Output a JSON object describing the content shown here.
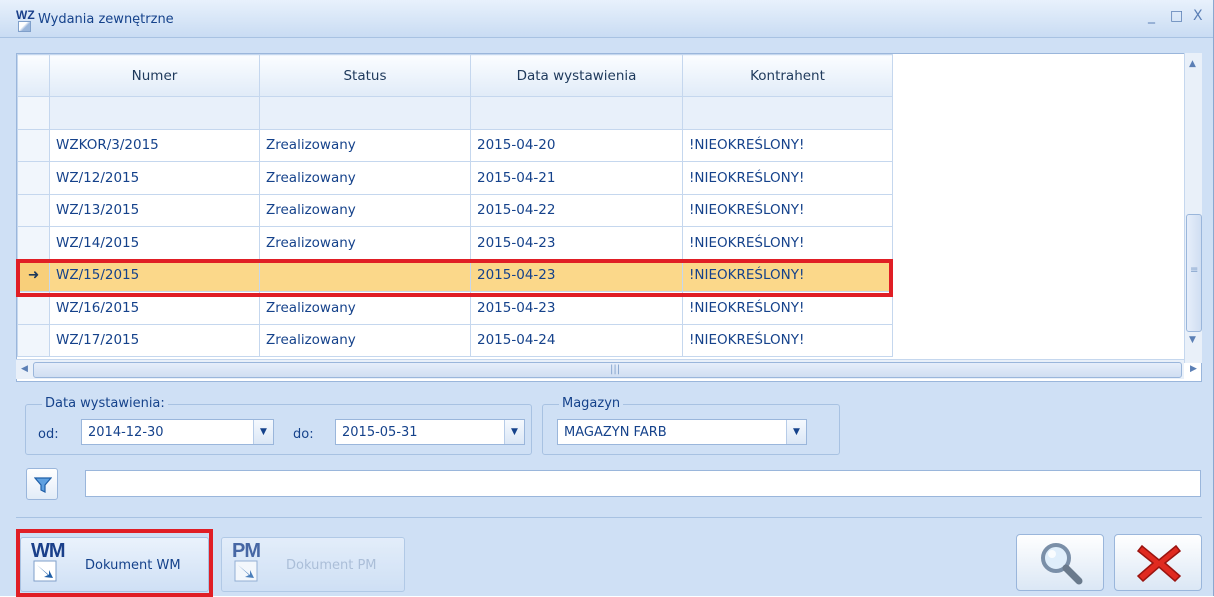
{
  "window": {
    "title": "Wydania zewnętrzne",
    "logo_text": "WZ",
    "minimize_glyph": "_",
    "maximize_glyph": "□",
    "close_glyph": "X"
  },
  "grid": {
    "columns": [
      "Numer",
      "Status",
      "Data wystawienia",
      "Kontrahent"
    ],
    "selected_indicator": "➜",
    "rows": [
      {
        "numer": "WZKOR/3/2015",
        "status": "Zrealizowany",
        "data": "2015-04-20",
        "kontrahent": "!NIEOKREŚLONY!"
      },
      {
        "numer": "WZ/12/2015",
        "status": "Zrealizowany",
        "data": "2015-04-21",
        "kontrahent": "!NIEOKREŚLONY!"
      },
      {
        "numer": "WZ/13/2015",
        "status": "Zrealizowany",
        "data": "2015-04-22",
        "kontrahent": "!NIEOKREŚLONY!"
      },
      {
        "numer": "WZ/14/2015",
        "status": "Zrealizowany",
        "data": "2015-04-23",
        "kontrahent": "!NIEOKREŚLONY!"
      },
      {
        "numer": "WZ/15/2015",
        "status": "",
        "data": "2015-04-23",
        "kontrahent": "!NIEOKREŚLONY!"
      },
      {
        "numer": "WZ/16/2015",
        "status": "Zrealizowany",
        "data": "2015-04-23",
        "kontrahent": "!NIEOKREŚLONY!"
      },
      {
        "numer": "WZ/17/2015",
        "status": "Zrealizowany",
        "data": "2015-04-24",
        "kontrahent": "!NIEOKREŚLONY!"
      }
    ]
  },
  "filters": {
    "date_group_label": "Data wystawienia:",
    "from_label": "od:",
    "from_value": "2014-12-30",
    "to_label": "do:",
    "to_value": "2015-05-31",
    "warehouse_group_label": "Magazyn",
    "warehouse_value": "MAGAZYN FARB",
    "search_value": ""
  },
  "buttons": {
    "wm_icon_text": "WM",
    "wm_label": "Dokument WM",
    "pm_icon_text": "PM",
    "pm_label": "Dokument PM"
  },
  "colors": {
    "accent": "#15428b",
    "selection": "#fbd88a",
    "highlight_border": "#e01e25",
    "disabled_text": "#9fb3cf"
  }
}
